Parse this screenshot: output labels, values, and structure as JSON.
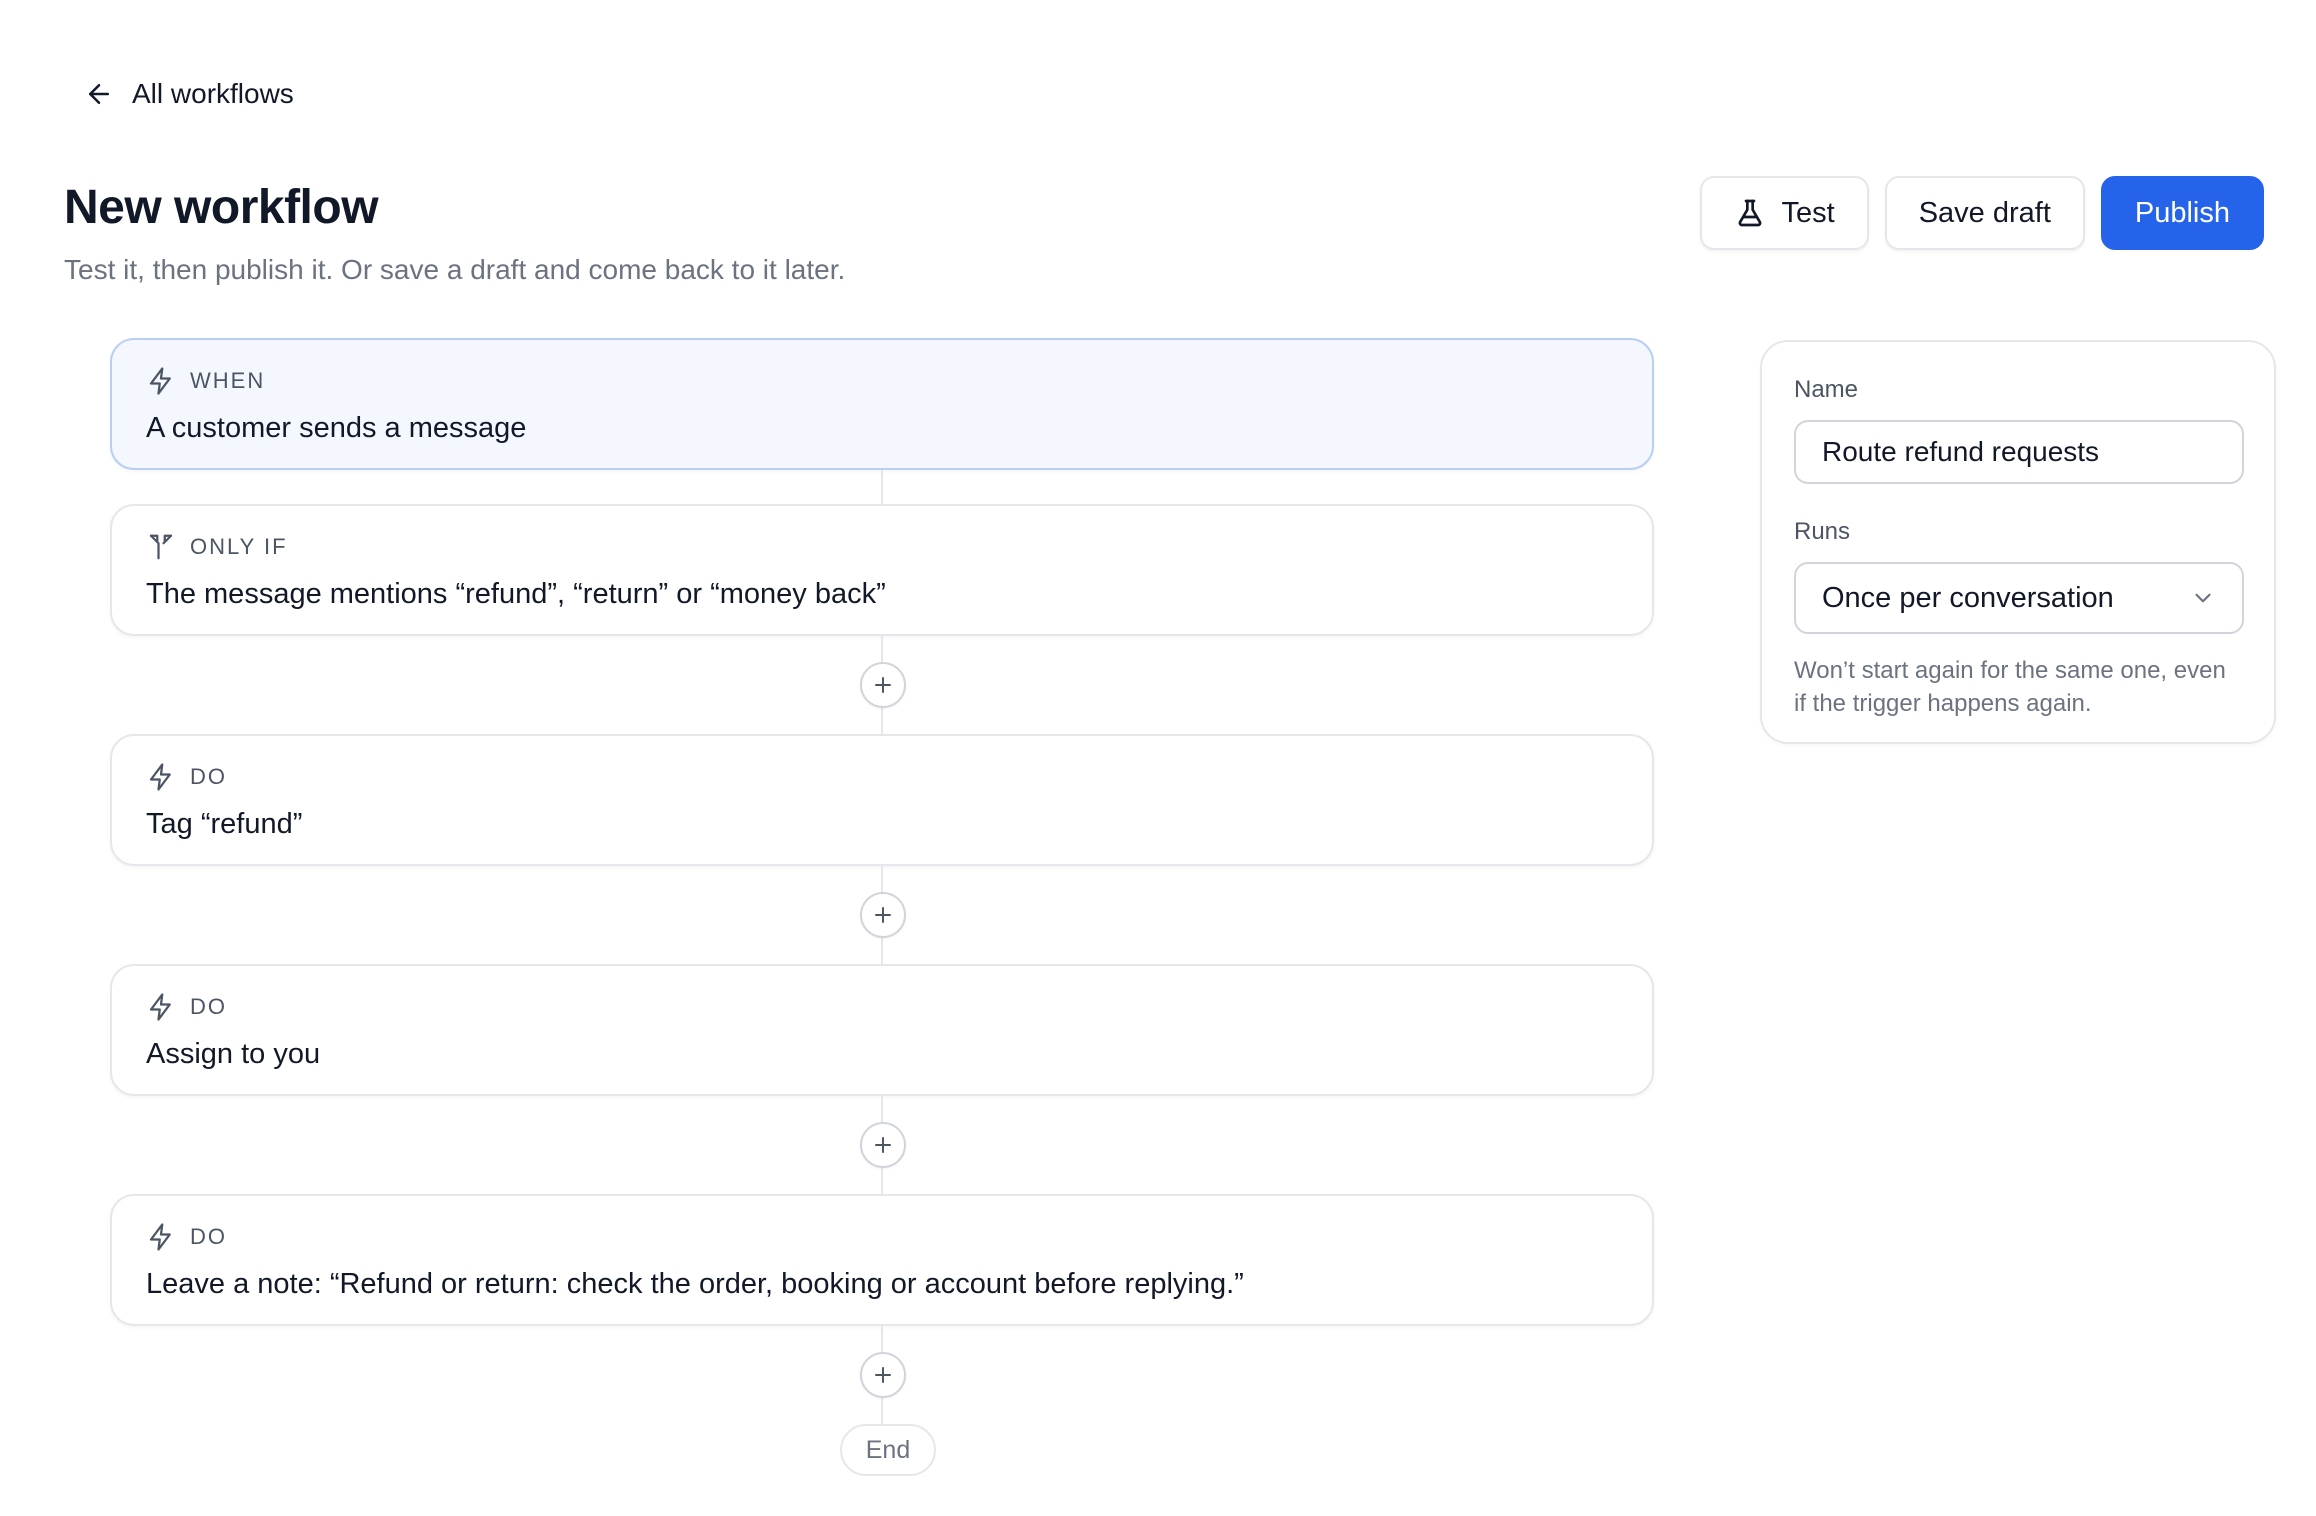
{
  "nav": {
    "back_label": "All workflows"
  },
  "header": {
    "title": "New workflow",
    "subtitle": "Test it, then publish it. Or save a draft and come back to it later."
  },
  "actions": {
    "test_label": "Test",
    "save_draft_label": "Save draft",
    "publish_label": "Publish"
  },
  "flow": {
    "trigger": {
      "label": "WHEN",
      "text": "A customer sends a message",
      "icon": "bolt-icon"
    },
    "condition": {
      "label": "ONLY IF",
      "text": "The message mentions “refund”, “return” or “money back”",
      "icon": "split-icon"
    },
    "steps": [
      {
        "label": "DO",
        "text": "Tag “refund”",
        "icon": "bolt-icon"
      },
      {
        "label": "DO",
        "text": "Assign to you",
        "icon": "bolt-icon"
      },
      {
        "label": "DO",
        "text": "Leave a note: “Refund or return: check the order, booking or account before replying.”",
        "icon": "bolt-icon"
      }
    ],
    "end_label": "End"
  },
  "settings": {
    "name_label": "Name",
    "name_value": "Route refund requests",
    "runs_label": "Runs",
    "runs_value": "Once per conversation",
    "runs_help": "Won’t start again for the same one, even if the trigger happens again."
  },
  "colors": {
    "primary": "#2563eb",
    "trigger_bg": "#f4f8fe",
    "trigger_border": "#b8cff3"
  }
}
